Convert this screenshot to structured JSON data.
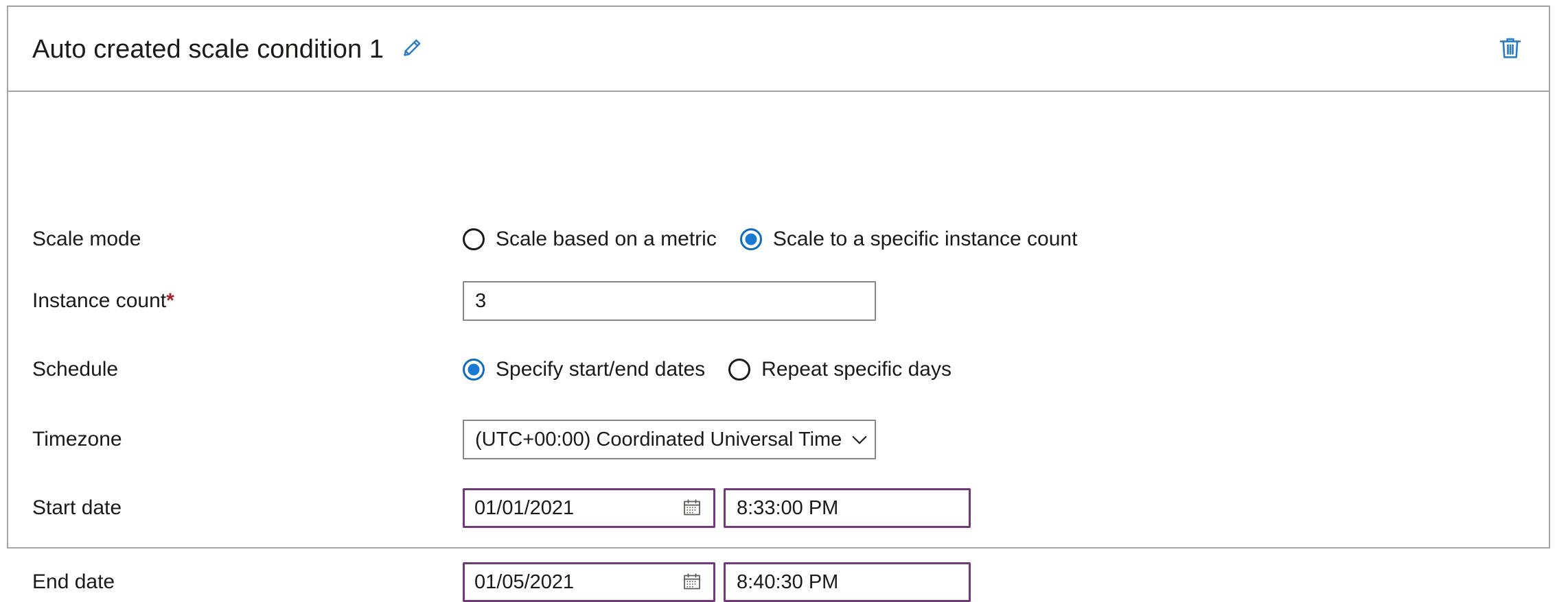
{
  "card": {
    "title": "Auto created scale condition 1",
    "edit_icon": "pencil-icon",
    "delete_icon": "trash-icon",
    "accent_blue": "#2b7cc4",
    "field_purple": "#71387a",
    "required_red": "#a4262c"
  },
  "rows": {
    "scale_mode": {
      "label": "Scale mode",
      "options": [
        {
          "label": "Scale based on a metric",
          "selected": false
        },
        {
          "label": "Scale to a specific instance count",
          "selected": true
        }
      ]
    },
    "instance_count": {
      "label": "Instance count",
      "required_marker": "*",
      "value": "3"
    },
    "schedule": {
      "label": "Schedule",
      "options": [
        {
          "label": "Specify start/end dates",
          "selected": true
        },
        {
          "label": "Repeat specific days",
          "selected": false
        }
      ]
    },
    "timezone": {
      "label": "Timezone",
      "value": "(UTC+00:00) Coordinated Universal Time",
      "chevron_icon": "chevron-down-icon"
    },
    "start_date": {
      "label": "Start date",
      "date": "01/01/2021",
      "time": "8:33:00 PM",
      "calendar_icon": "calendar-icon"
    },
    "end_date": {
      "label": "End date",
      "date": "01/05/2021",
      "time": "8:40:30 PM",
      "calendar_icon": "calendar-icon"
    }
  }
}
